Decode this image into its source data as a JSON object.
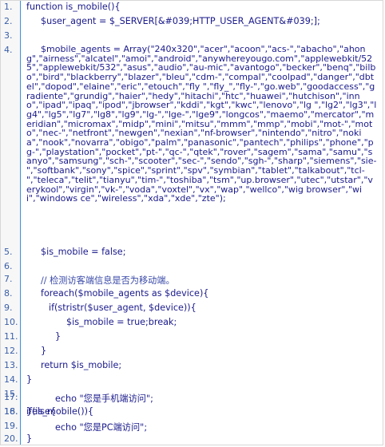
{
  "lines": [
    {
      "num": "1.",
      "text": "function is_mobile(){"
    },
    {
      "num": "2.",
      "text": "$user_agent = $_SERVER[&#039;HTTP_USER_AGENT&#039;];"
    },
    {
      "num": "3.",
      "text": ""
    },
    {
      "num": "4.",
      "text": "$mobile_agents = Array(\"240x320\",\"acer\",\"acoon\",\"acs-\",\"abacho\",\"ahong\",\"airness\",\"alcatel\",\"amoi\",\"android\",\"anywhereyougo.com\",\"applewebkit/525\",\"applewebkit/532\",\"asus\",\"audio\",\"au-mic\",\"avantogo\",\"becker\",\"benq\",\"bilbo\",\"bird\",\"blackberry\",\"blazer\",\"bleu\",\"cdm-\",\"compal\",\"coolpad\",\"danger\",\"dbtel\",\"dopod\",\"elaine\",\"eric\",\"etouch\",\"fly \",\"fly_\",\"fly-\",\"go.web\",\"goodaccess\",\"gradiente\",\"grundig\",\"haier\",\"hedy\",\"hitachi\",\"htc\",\"huawei\",\"hutchison\",\"inno\",\"ipad\",\"ipaq\",\"ipod\",\"jbrowser\",\"kddi\",\"kgt\",\"kwc\",\"lenovo\",\"lg \",\"lg2\",\"lg3\",\"lg4\",\"lg5\",\"lg7\",\"lg8\",\"lg9\",\"lg-\",\"lge-\",\"lge9\",\"longcos\",\"maemo\",\"mercator\",\"meridian\",\"micromax\",\"midp\",\"mini\",\"mitsu\",\"mmm\",\"mmp\",\"mobi\",\"mot-\",\"moto\",\"nec-\",\"netfront\",\"newgen\",\"nexian\",\"nf-browser\",\"nintendo\",\"nitro\",\"nokia\",\"nook\",\"novarra\",\"obigo\",\"palm\",\"panasonic\",\"pantech\",\"philips\",\"phone\",\"pg-\",\"playstation\",\"pocket\",\"pt-\",\"qc-\",\"qtek\",\"rover\",\"sagem\",\"sama\",\"samu\",\"sanyo\",\"samsung\",\"sch-\",\"scooter\",\"sec-\",\"sendo\",\"sgh-\",\"sharp\",\"siemens\",\"sie-\",\"softbank\",\"sony\",\"spice\",\"sprint\",\"spv\",\"symbian\",\"tablet\",\"talkabout\",\"tcl-\",\"teleca\",\"telit\",\"tianyu\",\"tim-\",\"toshiba\",\"tsm\",\"up.browser\",\"utec\",\"utstar\",\"verykool\",\"virgin\",\"vk-\",\"voda\",\"voxtel\",\"vx\",\"wap\",\"wellco\",\"wig browser\",\"wii\",\"windows ce\",\"wireless\",\"xda\",\"xde\",\"zte\");"
    },
    {
      "num": "5.",
      "text": "$is_mobile = false;"
    },
    {
      "num": "6.",
      "text": ""
    },
    {
      "num": "7.",
      "text": "// 检测访客端信息是否为移动端。"
    },
    {
      "num": "8.",
      "text": "foreach($mobile_agents as $device){"
    },
    {
      "num": "9.",
      "text": "if(stristr($user_agent, $device)){"
    },
    {
      "num": "10.",
      "text": "$is_mobile = true;break;"
    },
    {
      "num": "11.",
      "text": "}"
    },
    {
      "num": "12.",
      "text": "}"
    },
    {
      "num": "13.",
      "text": "return $is_mobile;"
    },
    {
      "num": "14.",
      "text": "}"
    },
    {
      "num": "15.",
      "text": ""
    },
    {
      "num": "16.",
      "text": "if(is_mobile()){"
    },
    {
      "num": "17.",
      "text": "echo \"您是手机端访问\";"
    },
    {
      "num": "18.",
      "text": "}else{"
    },
    {
      "num": "19.",
      "text": "echo \"您是PC端访问\";"
    },
    {
      "num": "20.",
      "text": "}"
    }
  ]
}
